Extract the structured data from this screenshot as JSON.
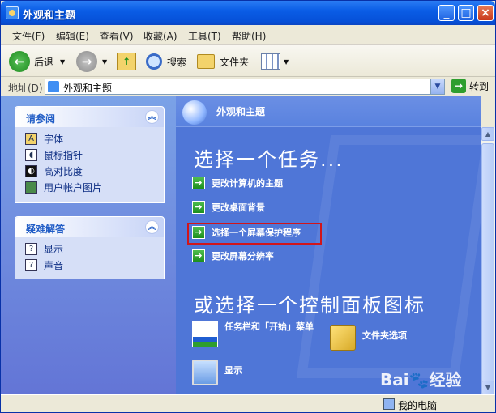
{
  "window": {
    "title": "外观和主题",
    "controls": [
      "_",
      "□",
      "×"
    ]
  },
  "menu": [
    "文件(F)",
    "编辑(E)",
    "查看(V)",
    "收藏(A)",
    "工具(T)",
    "帮助(H)"
  ],
  "toolbar": {
    "back": "后退",
    "search": "搜索",
    "folders": "文件夹"
  },
  "address": {
    "label": "地址(D)",
    "value": "外观和主题",
    "go": "转到"
  },
  "sidebar": {
    "see_also": {
      "title": "请参阅",
      "items": [
        "字体",
        "鼠标指针",
        "高对比度",
        "用户帐户图片"
      ]
    },
    "troubleshoot": {
      "title": "疑难解答",
      "items": [
        "显示",
        "声音"
      ]
    }
  },
  "content": {
    "header": "外观和主题",
    "pick_task": "选择一个任务...",
    "tasks": [
      "更改计算机的主题",
      "更改桌面背景",
      "选择一个屏幕保护程序",
      "更改屏幕分辨率"
    ],
    "or_pick": "或选择一个控制面板图标",
    "icons": {
      "taskbar": "任务栏和「开始」菜单",
      "folder_options": "文件夹选项",
      "display": "显示"
    }
  },
  "status": {
    "computer": "我的电脑"
  },
  "watermark": "Bai🐾经验"
}
